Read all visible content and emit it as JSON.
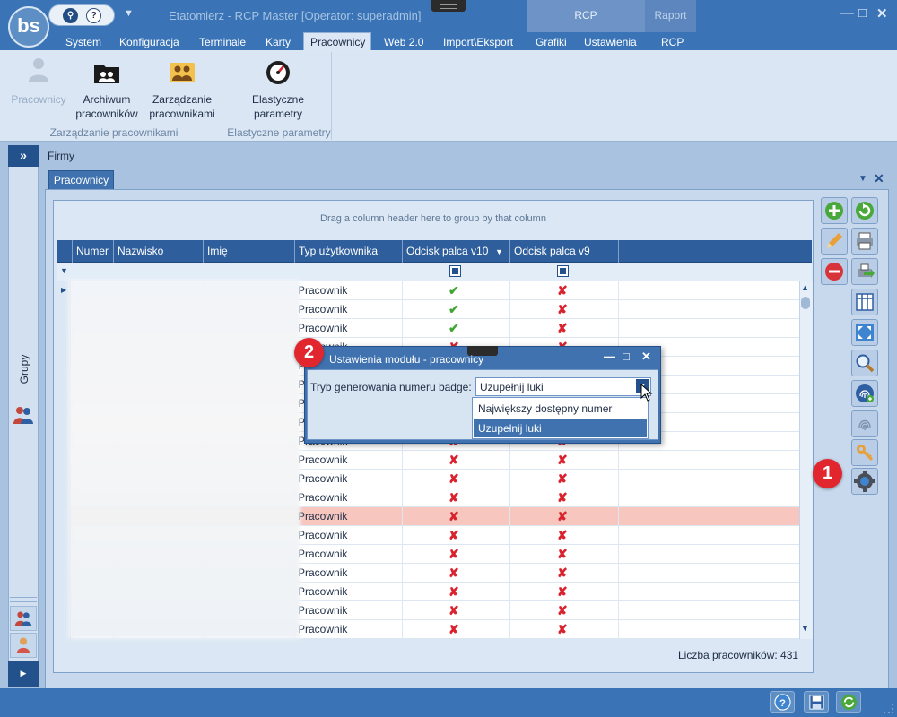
{
  "titlebar": {
    "logo_text": "bs",
    "app_title": "Etatomierz - RCP Master [Operator: superadmin]",
    "quick_access": {
      "search_icon": "search-icon",
      "help_label": "?"
    },
    "context_groups": [
      "RCP",
      "Raport"
    ]
  },
  "menu": {
    "items": [
      "System",
      "Konfiguracja",
      "Terminale",
      "Karty",
      "Pracownicy",
      "Web 2.0",
      "Import\\Eksport",
      "Grafiki",
      "Ustawienia",
      "RCP"
    ],
    "active": "Pracownicy"
  },
  "ribbon": {
    "groups": [
      {
        "label": "Zarządzanie pracownikami",
        "buttons": [
          {
            "label_1": "Pracownicy",
            "label_2": "",
            "icon": "person-icon",
            "enabled": false
          },
          {
            "label_1": "Archiwum",
            "label_2": "pracowników",
            "icon": "archive-folder-icon",
            "enabled": true
          },
          {
            "label_1": "Zarządzanie",
            "label_2": "pracownikami",
            "icon": "people-management-icon",
            "enabled": true
          }
        ]
      },
      {
        "label": "Elastyczne parametry",
        "buttons": [
          {
            "label_1": "Elastyczne",
            "label_2": "parametry",
            "icon": "gauge-icon",
            "enabled": true
          }
        ]
      }
    ]
  },
  "left_panel": {
    "label": "Grupy",
    "expand_glyph": "»"
  },
  "main": {
    "breadcrumb": "Firmy",
    "tab": "Pracownicy",
    "group_hint": "Drag a column header here to group by that column",
    "columns": [
      "Numer",
      "Nazwisko",
      "Imię",
      "Typ użytkownika",
      "Odcisk palca v10",
      "Odcisk palca v9"
    ],
    "rows": [
      {
        "typ": "Pracownik",
        "v10": true,
        "v9": false
      },
      {
        "typ": "Pracownik",
        "v10": true,
        "v9": false
      },
      {
        "typ": "Pracownik",
        "v10": true,
        "v9": false
      },
      {
        "typ": "Pracownik",
        "v10": false,
        "v9": false
      },
      {
        "typ": "Pracownik",
        "v10": false,
        "v9": false
      },
      {
        "typ": "Pracownik",
        "v10": false,
        "v9": false
      },
      {
        "typ": "Pracownik",
        "v10": false,
        "v9": false
      },
      {
        "typ": "Pracownik",
        "v10": false,
        "v9": false
      },
      {
        "typ": "Pracownik",
        "v10": false,
        "v9": false
      },
      {
        "typ": "Pracownik",
        "v10": false,
        "v9": false
      },
      {
        "typ": "Pracownik",
        "v10": false,
        "v9": false
      },
      {
        "typ": "Pracownik",
        "v10": false,
        "v9": false
      },
      {
        "typ": "Pracownik",
        "v10": false,
        "v9": false,
        "highlighted": true
      },
      {
        "typ": "Pracownik",
        "v10": false,
        "v9": false
      },
      {
        "typ": "Pracownik",
        "v10": false,
        "v9": false
      },
      {
        "typ": "Pracownik",
        "v10": false,
        "v9": false
      },
      {
        "typ": "Pracownik",
        "v10": false,
        "v9": false
      },
      {
        "typ": "Pracownik",
        "v10": false,
        "v9": false
      },
      {
        "typ": "Pracownik",
        "v10": false,
        "v9": false
      }
    ],
    "count_label": "Liczba pracowników: 431"
  },
  "toolbar": {
    "buttons": [
      "add-icon",
      "refresh-icon",
      "edit-icon",
      "print-icon",
      "delete-icon",
      "export-icon",
      "columns-icon",
      "fit-icon",
      "search-icon",
      "fingerprint-add-icon",
      "fingerprint-icon",
      "key-icon",
      "settings-gear-icon"
    ]
  },
  "badges": {
    "one": "1",
    "two": "2"
  },
  "dialog": {
    "title": "Ustawienia modułu - pracownicy",
    "field_label": "Tryb generowania numeru badge:",
    "select_value": "Uzupełnij luki",
    "options": [
      "Największy dostępny numer",
      "Uzupełnij luki"
    ]
  },
  "colors": {
    "accent": "#3a74b6",
    "header": "#2e5e9c",
    "highlight_row": "#f7c6bf",
    "check": "#3fa636",
    "cross": "#d9222d",
    "badge": "#e1262e"
  }
}
